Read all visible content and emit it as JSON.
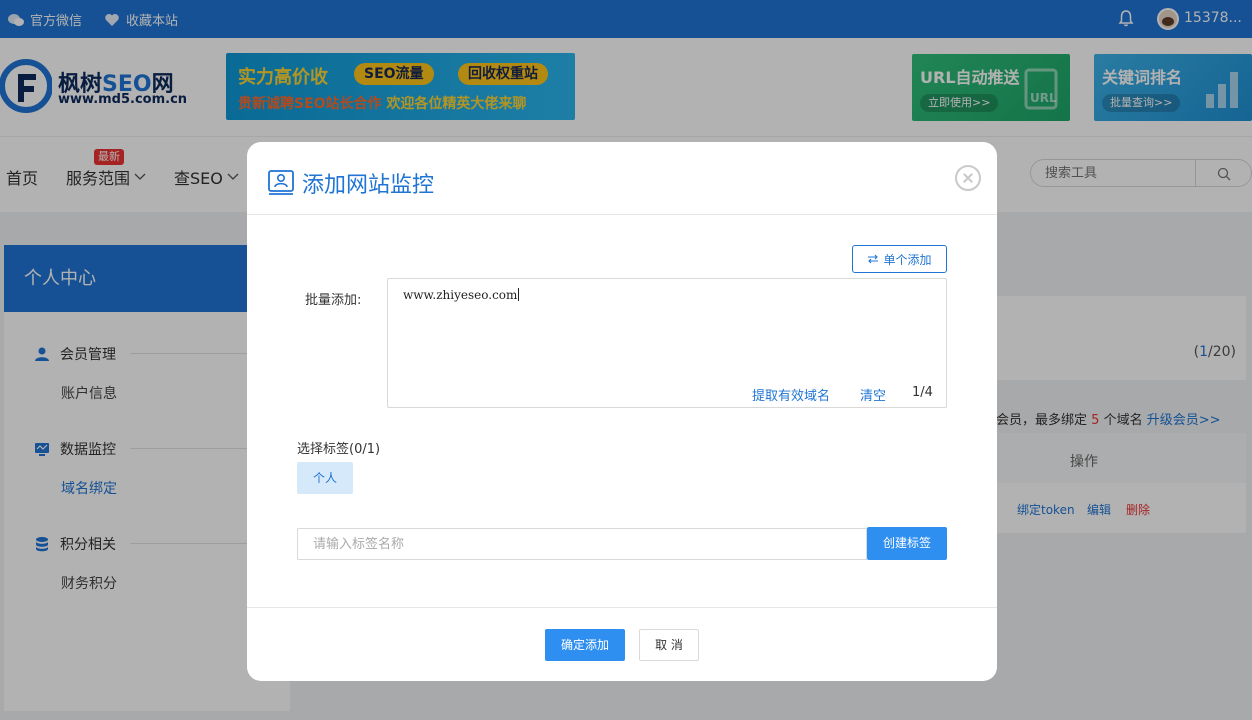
{
  "topbar": {
    "wechat": "官方微信",
    "favorite": "收藏本站",
    "username": "15378..."
  },
  "logo": {
    "title_pre": "枫树",
    "title_seo": "SEO",
    "title_post": "网",
    "url": "www.md5.com.cn"
  },
  "banners": {
    "main_line1": "实力高价收",
    "main_pill1": "SEO流量",
    "main_pill2": "回收权重站",
    "main_line2_a": "贵新诚聘SEO站长合作",
    "main_line2_b": "欢迎各位精英大佬来聊",
    "url_push_title": "URL自动推送",
    "url_push_btn": "立即使用>>",
    "keyword_title": "关键词排名",
    "keyword_btn": "批量查询>>"
  },
  "nav": {
    "home": "首页",
    "services": "服务范围",
    "new_badge": "最新",
    "check_seo": "查SEO",
    "search_placeholder": "搜索工具"
  },
  "sidebar": {
    "header": "个人中心",
    "sections": [
      {
        "label": "会员管理",
        "sub": "账户信息"
      },
      {
        "label": "数据监控",
        "sub": "域名绑定"
      },
      {
        "label": "积分相关",
        "sub": "财务积分"
      }
    ]
  },
  "main": {
    "count_open": "(",
    "count_current": "1",
    "count_total": "/20)",
    "member_text_a": "会员，最多绑定",
    "member_num": "5",
    "member_text_b": "个域名",
    "upgrade": "升级会员>>",
    "col_operation": "操作",
    "action_token": "绑定token",
    "action_edit": "编辑",
    "action_delete": "删除"
  },
  "modal": {
    "title": "添加网站监控",
    "single_add": "单个添加",
    "bulk_label": "批量添加:",
    "textarea_value": "www.zhiyeseo.com",
    "extract": "提取有效域名",
    "clear": "清空",
    "line_count": "1/4",
    "tag_title": "选择标签(0/1)",
    "tag_chip": "个人",
    "tag_placeholder": "请输入标签名称",
    "create_tag": "创建标签",
    "confirm": "确定添加",
    "cancel": "取 消"
  },
  "colors": {
    "primary": "#1f74d4",
    "button": "#2f8ff0",
    "danger": "#e33333"
  }
}
